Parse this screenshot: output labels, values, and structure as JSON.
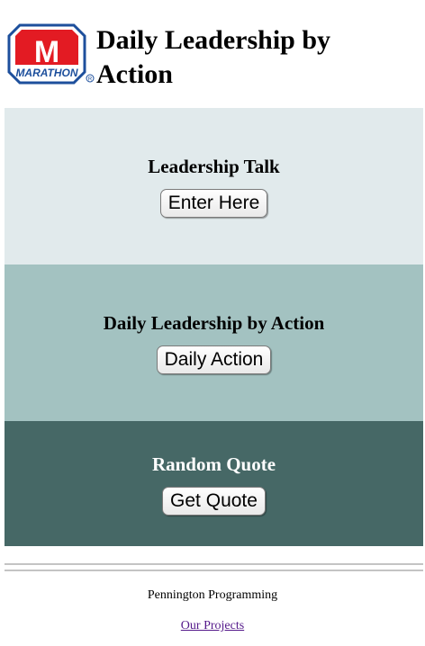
{
  "header": {
    "logo_text": "MARATHON",
    "logo_mark": "M",
    "title": "Daily Leadership by Action"
  },
  "panels": [
    {
      "heading": "Leadership Talk",
      "button": "Enter Here"
    },
    {
      "heading": "Daily Leadership by Action",
      "button": "Daily Action"
    },
    {
      "heading": "Random Quote",
      "button": "Get Quote"
    }
  ],
  "footer": {
    "credit": "Pennington Programming",
    "link": "Our Projects"
  },
  "colors": {
    "brand_red": "#e31b23",
    "brand_blue": "#1d4f9c",
    "panel_light": "#e1eaec",
    "panel_mid": "#a3c2c1",
    "panel_dark": "#466866",
    "visited_link": "#551a8b"
  },
  "icons": [
    "marathon-logo-icon",
    "registered-mark-icon"
  ]
}
